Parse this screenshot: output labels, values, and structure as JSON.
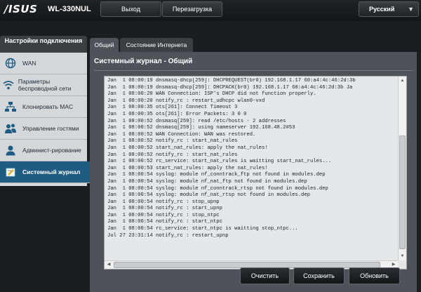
{
  "header": {
    "logo": "/ISUS",
    "model": "WL-330NUL",
    "logout_label": "Выход",
    "reboot_label": "Перезагрузка",
    "language": "Русский"
  },
  "sidebar": {
    "title": "Настройки подключения",
    "items": [
      {
        "label": "WAN",
        "icon": "globe-icon"
      },
      {
        "label": "Параметры беспроводной сети",
        "icon": "wifi-icon"
      },
      {
        "label": "Клонировать MAC",
        "icon": "network-icon"
      },
      {
        "label": "Управление гостями",
        "icon": "users-icon"
      },
      {
        "label": "Админист-рирование",
        "icon": "admin-user-icon"
      },
      {
        "label": "Системный журнал",
        "icon": "log-icon",
        "active": true
      }
    ]
  },
  "tabs": [
    {
      "label": "Общий",
      "active": true
    },
    {
      "label": "Состояние Интернета",
      "active": false
    }
  ],
  "page_title": "Системный журнал - Общий",
  "log_text": "Jan  1 08:00:19 dnsmasq-dhcp[259]: DHCPREQUEST(br0) 192.168.1.17 60:a4:4c:46:2d:3b\nJan  1 08:00:19 dnsmasq-dhcp[259]: DHCPACK(br0) 192.168.1.17 60:a4:4c:46:2d:3b Ja\nJan  1 08:00:20 WAN Connection: ISP's DHCP did not function properly.\nJan  1 08:00:20 notify_rc : restart_udhcpc wlan0-vxd\nJan  1 08:00:35 ots[261]: Connect Timeout 3\nJan  1 08:00:35 ots[261]: Error Packets: 3 0 0\nJan  1 08:00:52 dnsmasq[259]: read /etc/hosts - 2 addresses\nJan  1 08:00:52 dnsmasq[259]: using nameserver 192.168.48.2#53\nJan  1 08:00:52 WAN Connection: WAN was restored.\nJan  1 08:00:52 notify_rc : start_nat_rules\nJan  1 08:00:52 start_nat_rules: apply the nat_rules!\nJan  1 08:00:52 notify_rc : start_nat_rules\nJan  1 08:00:52 rc_service: start_nat_rules is waitting start_nat_rules...\nJan  1 08:00:53 start_nat_rules: apply the nat_rules!\nJan  1 08:00:54 syslog: module nf_conntrack_ftp not found in modules.dep\nJan  1 08:00:54 syslog: module nf_nat_ftp not found in modules.dep\nJan  1 08:00:54 syslog: module nf_conntrack_rtsp not found in modules.dep\nJan  1 08:00:54 syslog: module nf_nat_rtsp not found in modules.dep\nJan  1 08:00:54 notify_rc : stop_upnp\nJan  1 08:00:54 notify_rc : start_upnp\nJan  1 08:00:54 notify_rc : stop_ntpc\nJan  1 08:00:54 notify_rc : start_ntpc\nJan  1 08:00:54 rc_service: start_ntpc is waitting stop_ntpc...\nJul 27 23:31:14 notify_rc : restart_upnp",
  "actions": {
    "clear_label": "Очистить",
    "save_label": "Сохранить",
    "refresh_label": "Обновить"
  },
  "colors": {
    "accent": "#1f5b82",
    "sidebar_bg": "#d4d8db",
    "panel_bg": "#4d5359",
    "log_bg": "#e4e8eb"
  }
}
